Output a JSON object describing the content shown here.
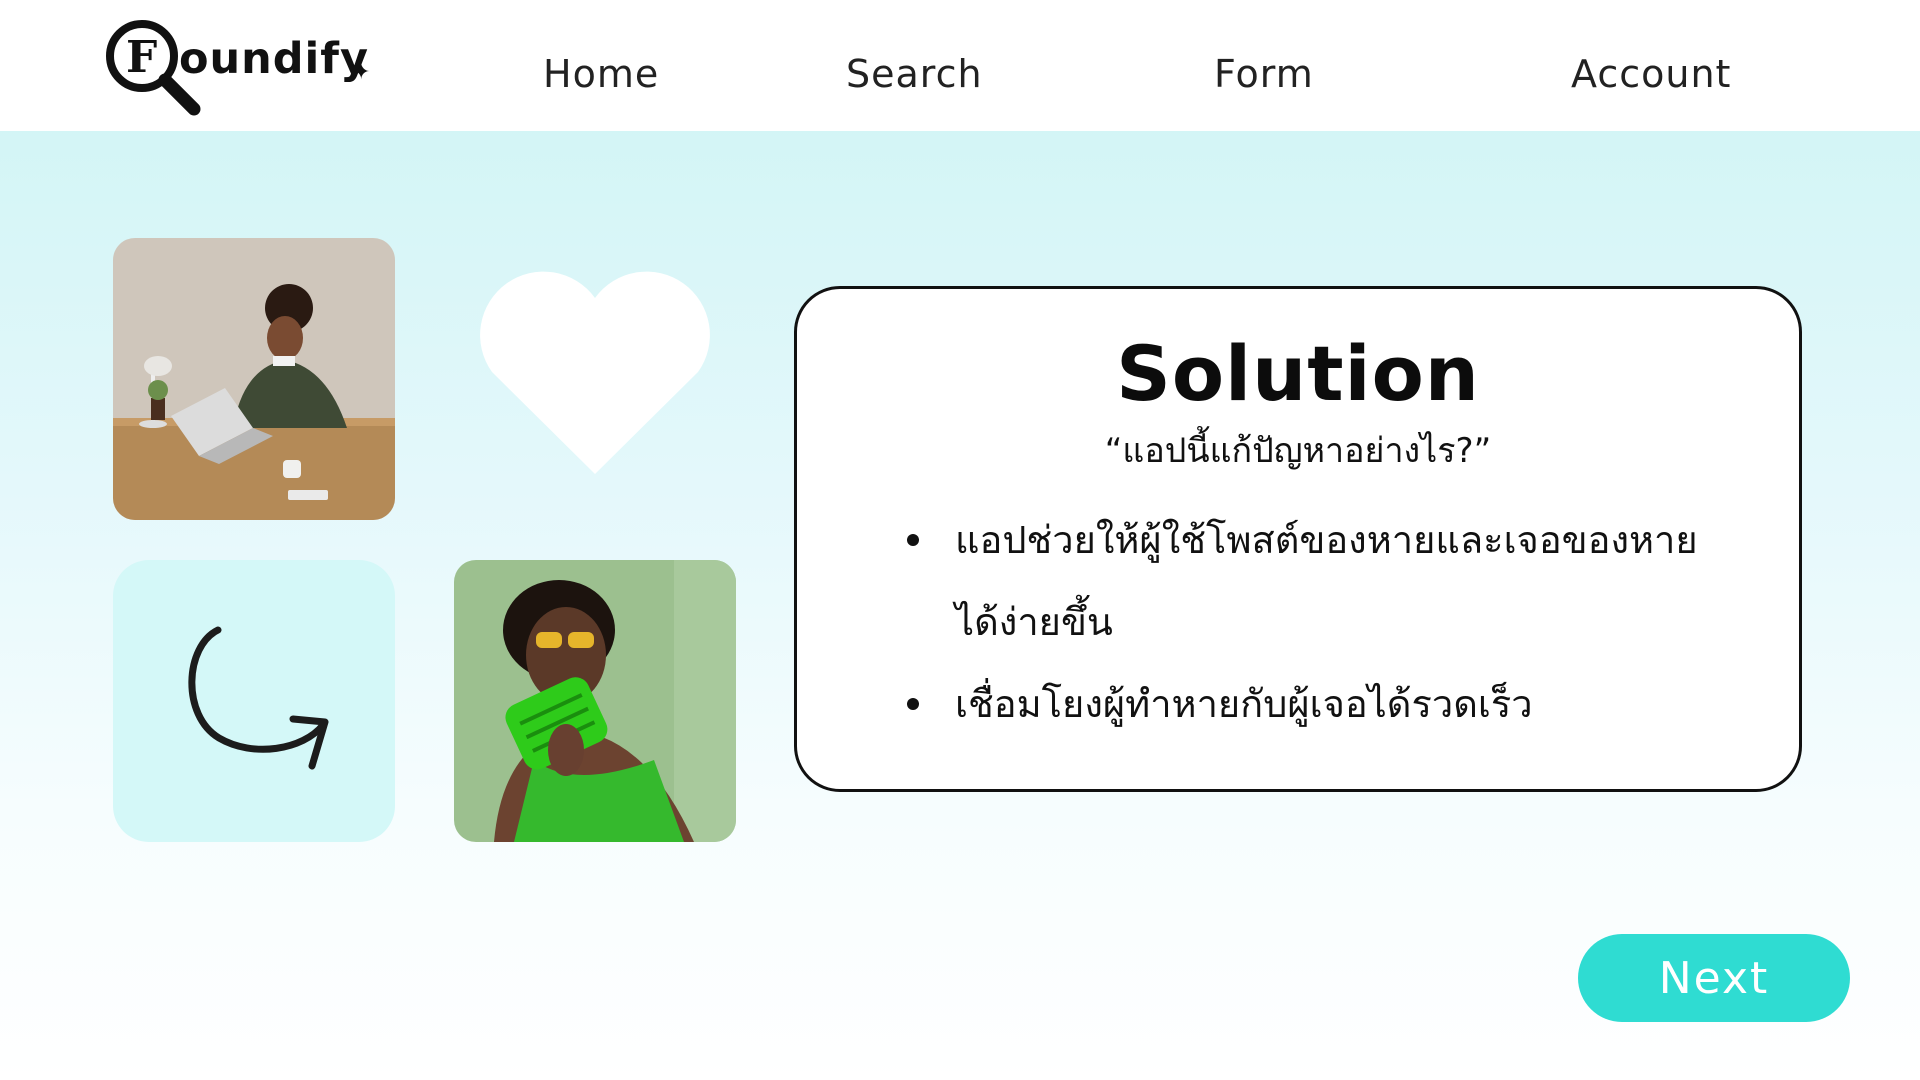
{
  "header": {
    "logo_text": "oundify",
    "logo_letter": "F",
    "nav": {
      "home": "Home",
      "search": "Search",
      "form": "Form",
      "account": "Account"
    }
  },
  "card": {
    "title": "Solution",
    "subtitle": "“แอปนี้แก้ปัญหาอย่างไร?”",
    "bullets": [
      "แอปช่วยให้ผู้ใช้โพสต์ของหายและเจอของหายได้ง่ายขึ้น",
      "เชื่อมโยงผู้ทำหายกับผู้เจอได้รวดเร็ว"
    ]
  },
  "next_button_label": "Next",
  "colors": {
    "accent": "#2fdcd2",
    "bg_top": "#cdf4f4",
    "tile": "#d4f8f8"
  },
  "icons": [
    "magnifier-logo-icon",
    "heart-icon",
    "curved-arrow-icon",
    "sparkle-icon"
  ]
}
